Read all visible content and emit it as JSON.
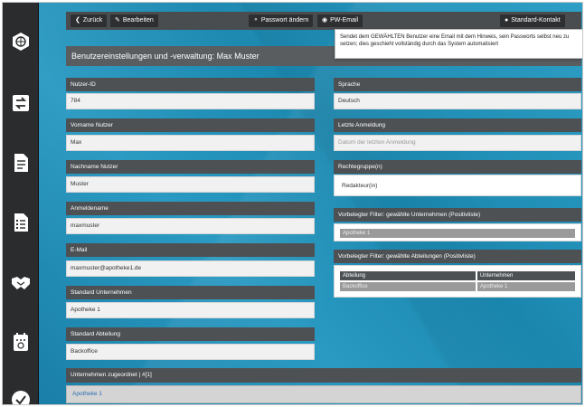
{
  "sidebar": {
    "icons": [
      "globe-icon",
      "exchange-icon",
      "document-icon",
      "checklist-icon",
      "handshake-icon",
      "calendar-icon",
      "checkmark-icon"
    ]
  },
  "toolbar": {
    "back_label": "Zurück",
    "edit_label": "Bearbeiten",
    "password_change_label": "Passwort ändern",
    "pw_email_label": "PW-Email",
    "standard_contact_label": "Standard-Kontakt"
  },
  "tooltip": {
    "text": "Sendet dem GEWÄHLTEN Benutzer eine Email mit dem Hinweis, sein Passworts selbst neu zu setzen; dies geschieht vollständig durch das System automatisiert"
  },
  "page": {
    "title": "Benutzereinstellungen und -verwaltung: Max Muster"
  },
  "form": {
    "user_id": {
      "label": "Nutzer-ID",
      "value": "784"
    },
    "first_name": {
      "label": "Vorname Nutzer",
      "value": "Max"
    },
    "last_name": {
      "label": "Nachname Nutzer",
      "value": "Muster"
    },
    "login_name": {
      "label": "Anmeldename",
      "value": "maxmuster"
    },
    "email": {
      "label": "E-Mail",
      "value": "maxmuster@apotheke1.de"
    },
    "standard_company": {
      "label": "Standard Unternehmen",
      "value": "Apotheke 1"
    },
    "standard_department": {
      "label": "Standard Abteilung",
      "value": "Backoffice"
    },
    "language": {
      "label": "Sprache",
      "value": "Deutsch"
    },
    "last_login": {
      "label": "Letzte Anmeldung",
      "placeholder": "Datum der letzten Anmeldung"
    },
    "rights_group": {
      "label": "Rechtegruppe(n)",
      "value": "Redakteur(in)"
    },
    "filter_companies": {
      "label": "Vorbelegter Filter: gewählte Unternehmen (Positivliste)",
      "value": "Apotheke 1"
    },
    "filter_departments": {
      "label": "Vorbelegter Filter: gewählte Abteilungen (Positivliste)",
      "columns": [
        "Abteilung",
        "Unternehmen"
      ],
      "rows": [
        [
          "Backoffice",
          "Apotheke 1"
        ]
      ]
    }
  },
  "assigned": {
    "label": "Unternehmen zugeordnet | #[1]",
    "items": [
      "Apotheke 1"
    ]
  }
}
